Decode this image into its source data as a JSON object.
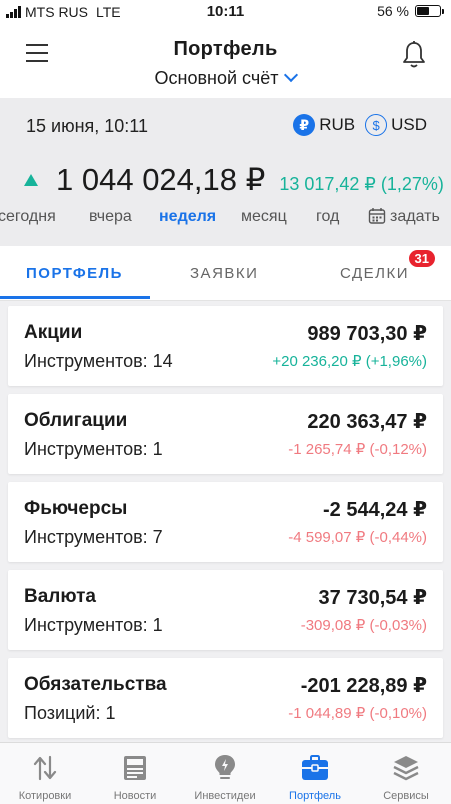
{
  "status": {
    "carrier": "MTS RUS",
    "network": "LTE",
    "time": "10:11",
    "battery": "56 %"
  },
  "header": {
    "title": "Портфель",
    "account": "Основной счёт"
  },
  "summary": {
    "date": "15 июня, 10:11",
    "currency_rub": "RUB",
    "currency_usd": "USD",
    "rub_symbol": "₽",
    "usd_symbol": "$",
    "total": "1 044 024,18 ₽",
    "change": "13 017,42 ₽ (1,27%)",
    "periods": [
      "сегодня",
      "вчера",
      "неделя",
      "месяц",
      "год",
      "задать"
    ],
    "active_period": "неделя"
  },
  "tabs": {
    "portfolio": "ПОРТФЕЛЬ",
    "orders": "ЗАЯВКИ",
    "deals": "СДЕЛКИ",
    "deals_badge": "31"
  },
  "cards": [
    {
      "name": "Акции",
      "sub": "Инструментов: 14",
      "value": "989 703,30 ₽",
      "change": "+20 236,20 ₽ (+1,96%)",
      "trend": "up"
    },
    {
      "name": "Облигации",
      "sub": "Инструментов: 1",
      "value": "220 363,47 ₽",
      "change": "-1 265,74 ₽ (-0,12%)",
      "trend": "down"
    },
    {
      "name": "Фьючерсы",
      "sub": "Инструментов: 7",
      "value": "-2 544,24 ₽",
      "change": "-4 599,07 ₽ (-0,44%)",
      "trend": "down"
    },
    {
      "name": "Валюта",
      "sub": "Инструментов: 1",
      "value": "37 730,54 ₽",
      "change": "-309,08 ₽ (-0,03%)",
      "trend": "down"
    },
    {
      "name": "Обязательства",
      "sub": "Позиций: 1",
      "value": "-201 228,89 ₽",
      "change": "-1 044,89 ₽ (-0,10%)",
      "trend": "down"
    }
  ],
  "nav": {
    "items": [
      "Котировки",
      "Новости",
      "Инвестидеи",
      "Портфель",
      "Сервисы"
    ],
    "active": "Портфель"
  },
  "colors": {
    "accent": "#1a73e8",
    "positive": "#17b39a",
    "negative": "#f07a80",
    "badge": "#e8232e"
  }
}
